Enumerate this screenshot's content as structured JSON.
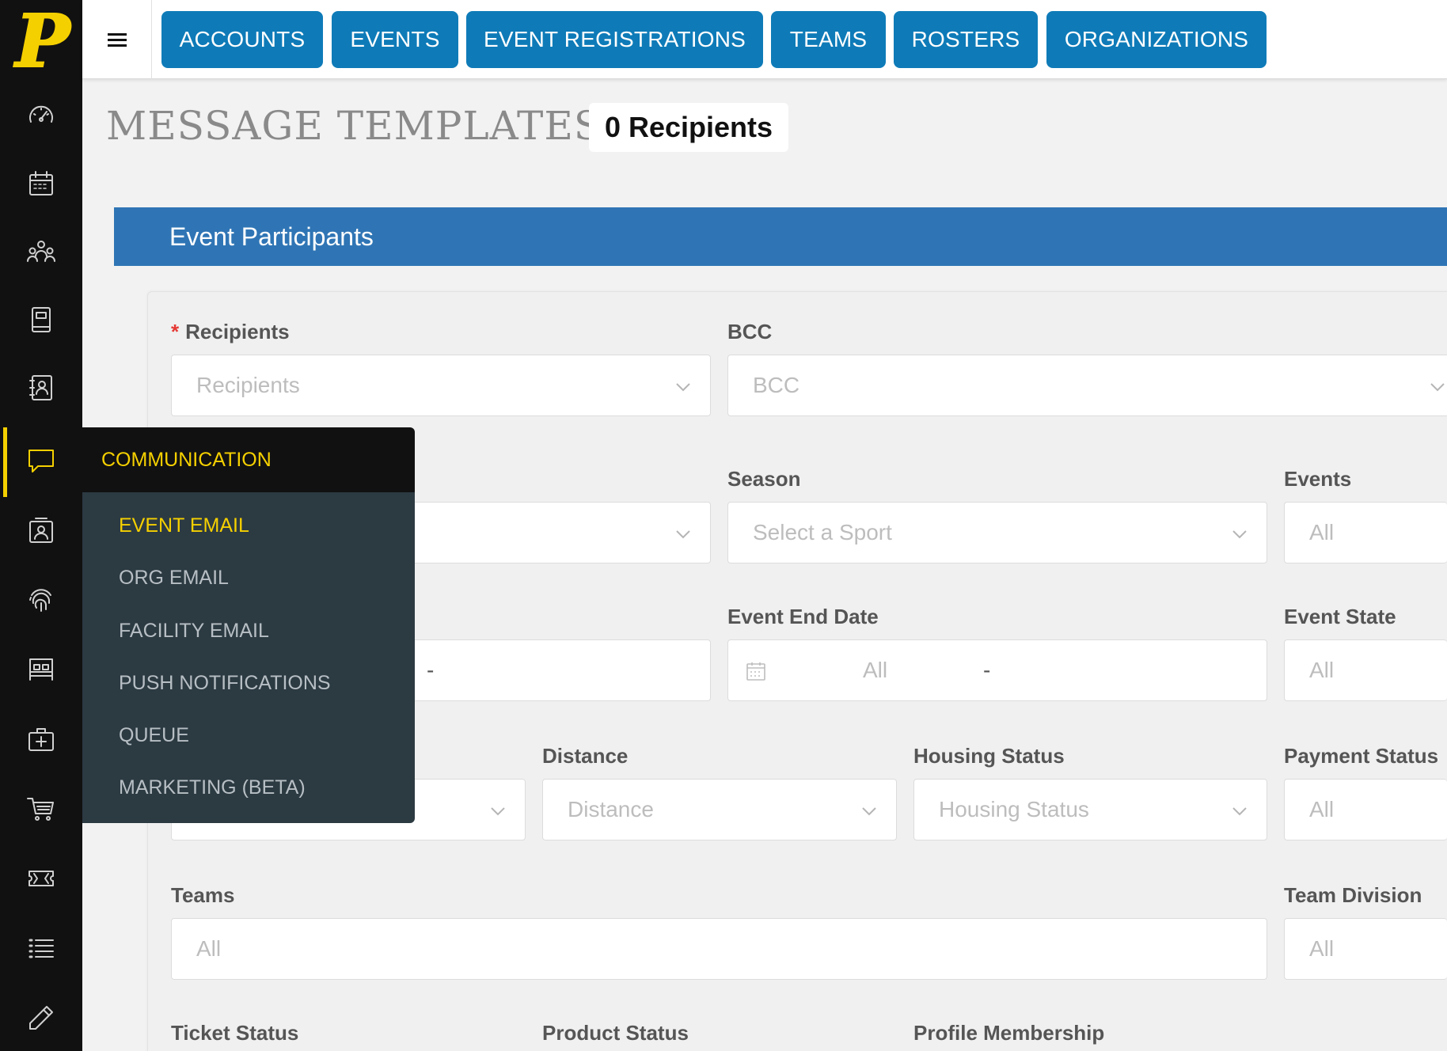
{
  "brand": {
    "logo_letter": "P",
    "accent": "#f5d000",
    "nav_color": "#0e7bb8",
    "panel_color": "#2f75b5"
  },
  "sidebar": {
    "icons": [
      "dashboard-icon",
      "calendar-icon",
      "people-icon",
      "book-icon",
      "contacts-icon",
      "chat-icon",
      "id-card-icon",
      "fingerprint-icon",
      "bed-icon",
      "medical-kit-icon",
      "cart-icon",
      "ticket-icon",
      "list-icon",
      "pencil-icon"
    ],
    "active": "chat-icon"
  },
  "topnav": {
    "menu_icon": "hamburger-icon",
    "tabs": [
      "ACCOUNTS",
      "EVENTS",
      "EVENT REGISTRATIONS",
      "TEAMS",
      "ROSTERS",
      "ORGANIZATIONS"
    ]
  },
  "header": {
    "title": "MESSAGE TEMPLATES",
    "recipients_badge": "0 Recipients"
  },
  "panel": {
    "title": "Event Participants"
  },
  "form": {
    "recipients": {
      "label": "Recipients",
      "required_mark": "*",
      "placeholder": "Recipients"
    },
    "bcc": {
      "label": "BCC",
      "placeholder": "BCC"
    },
    "season": {
      "label": "Season",
      "placeholder": "Select a Sport"
    },
    "events": {
      "label": "Events",
      "placeholder": "All"
    },
    "hidden_row2_field": {
      "separator": "-"
    },
    "event_end_date": {
      "label": "Event End Date",
      "placeholder": "All",
      "separator": "-"
    },
    "event_state": {
      "label": "Event State",
      "placeholder": "All"
    },
    "distance": {
      "label": "Distance",
      "placeholder": "Distance"
    },
    "housing_status": {
      "label": "Housing Status",
      "placeholder": "Housing Status"
    },
    "payment_status": {
      "label": "Payment Status",
      "placeholder": "All"
    },
    "teams": {
      "label": "Teams",
      "placeholder": "All"
    },
    "team_division": {
      "label": "Team Division",
      "placeholder": "All"
    },
    "ticket_status": {
      "label": "Ticket Status"
    },
    "product_status": {
      "label": "Product Status"
    },
    "profile_membership": {
      "label": "Profile Membership"
    }
  },
  "flyout": {
    "title": "COMMUNICATION",
    "items": [
      "EVENT EMAIL",
      "ORG EMAIL",
      "FACILITY EMAIL",
      "PUSH NOTIFICATIONS",
      "QUEUE",
      "MARKETING (BETA)"
    ],
    "active": "EVENT EMAIL"
  }
}
